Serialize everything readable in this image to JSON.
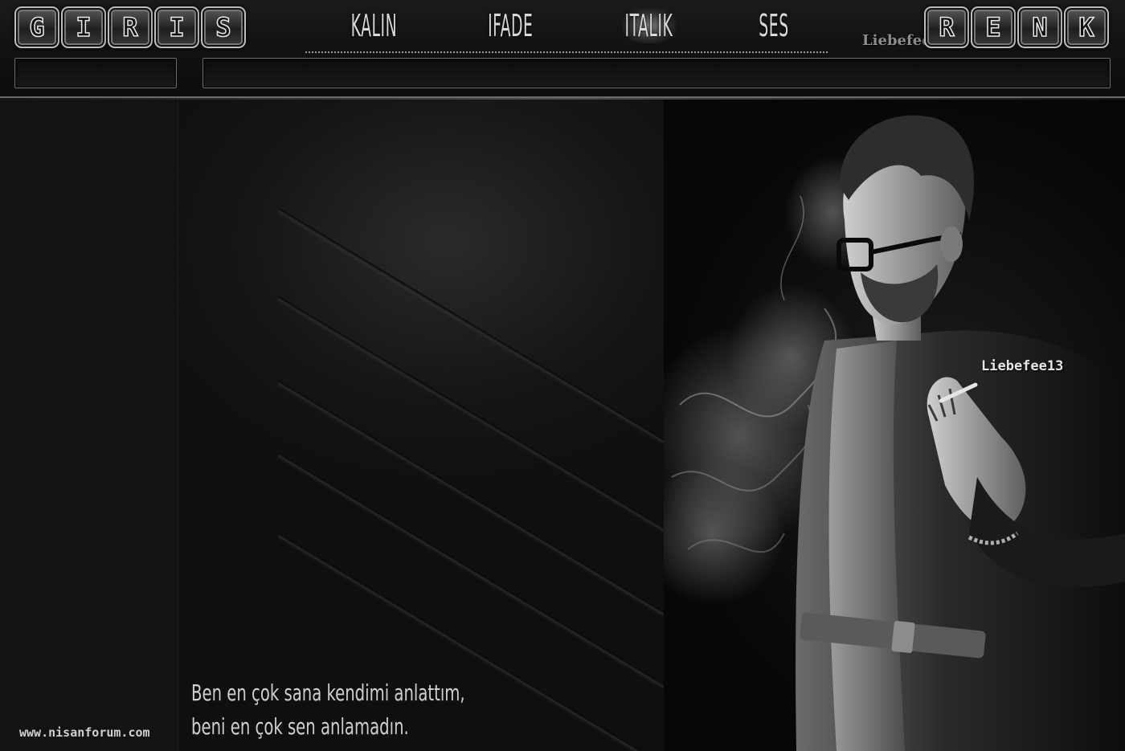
{
  "toolbar": {
    "left_tiles": [
      "G",
      "I",
      "R",
      "I",
      "S"
    ],
    "menu": [
      "KALIN",
      "IFADE",
      "ITALIK",
      "SES"
    ],
    "right_tiles": [
      "R",
      "E",
      "N",
      "K"
    ],
    "watermark": "Liebefeel3"
  },
  "footer": {
    "site_url": "www.nisanforum.com"
  },
  "quote": {
    "line1": "Ben en çok sana kendimi anlattım,",
    "line2": "beni en çok sen anlamadın."
  },
  "photo": {
    "watermark": "Liebefee13"
  },
  "colors": {
    "background": "#0a0a0a",
    "accent": "#bdbdbd",
    "text": "#d8d8d8"
  }
}
